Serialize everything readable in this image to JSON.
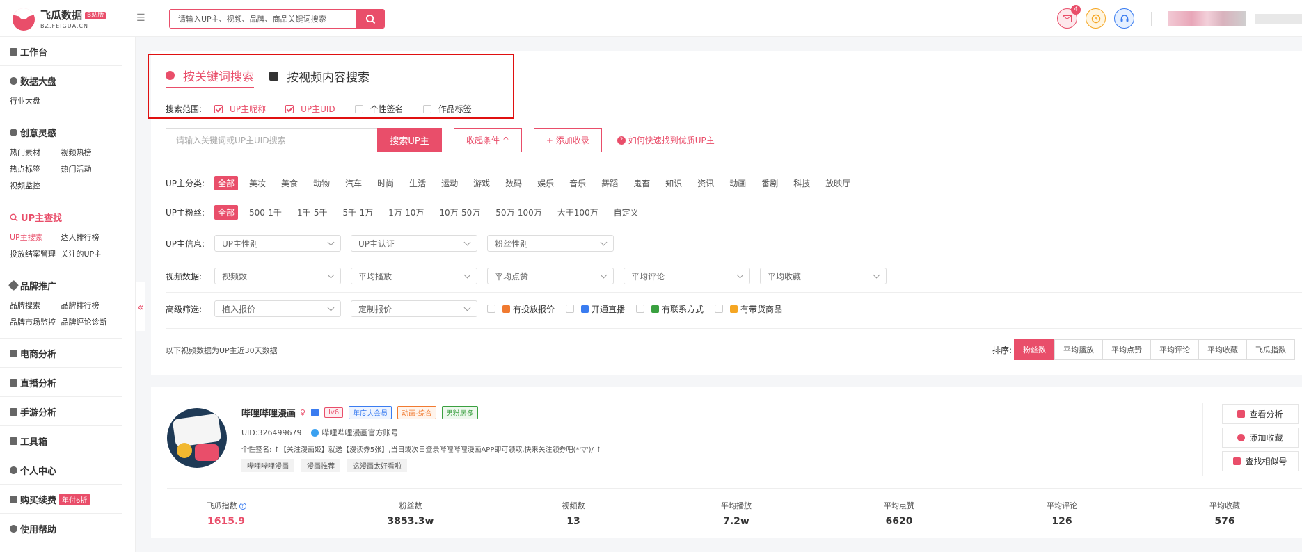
{
  "logo": {
    "name": "飞瓜数据",
    "badge": "B站版",
    "sub": "BZ.FEIGUA.CN"
  },
  "topbar": {
    "search_placeholder": "请输入UP主、视频、品牌、商品关键词搜索",
    "mail_count": "4"
  },
  "sidebar": {
    "groups": [
      {
        "title": "工作台",
        "items": []
      },
      {
        "title": "数据大盘",
        "items": [
          "行业大盘"
        ]
      },
      {
        "title": "创意灵感",
        "items": [
          "热门素材",
          "视频热榜",
          "热点标签",
          "热门活动",
          "视频监控"
        ]
      },
      {
        "title": "UP主查找",
        "items": [
          "UP主搜索",
          "达人排行榜",
          "投放结案管理",
          "关注的UP主"
        ]
      },
      {
        "title": "品牌推广",
        "items": [
          "品牌搜索",
          "品牌排行榜",
          "品牌市场监控",
          "品牌评论诊断"
        ]
      },
      {
        "title": "电商分析"
      },
      {
        "title": "直播分析"
      },
      {
        "title": "手游分析"
      },
      {
        "title": "工具箱"
      },
      {
        "title": "个人中心"
      },
      {
        "title": "购买续费",
        "badge": "年付6折"
      },
      {
        "title": "使用帮助"
      }
    ],
    "collapse": "«"
  },
  "tabs": [
    {
      "label": "按关键词搜索"
    },
    {
      "label": "按视频内容搜索"
    }
  ],
  "scope": {
    "label": "搜索范围:",
    "options": [
      "UP主昵称",
      "UP主UID",
      "个性签名",
      "作品标签"
    ]
  },
  "search": {
    "placeholder": "请输入关键词或UP主UID搜索",
    "button": "搜索UP主",
    "collapse": "收起条件 ^",
    "add": "+ 添加收录",
    "help": "如何快速找到优质UP主"
  },
  "filters": {
    "category": {
      "label": "UP主分类:",
      "options": [
        "全部",
        "美妆",
        "美食",
        "动物",
        "汽车",
        "时尚",
        "生活",
        "运动",
        "游戏",
        "数码",
        "娱乐",
        "音乐",
        "舞蹈",
        "鬼畜",
        "知识",
        "资讯",
        "动画",
        "番剧",
        "科技",
        "放映厅"
      ]
    },
    "fans": {
      "label": "UP主粉丝:",
      "options": [
        "全部",
        "500-1千",
        "1千-5千",
        "5千-1万",
        "1万-10万",
        "10万-50万",
        "50万-100万",
        "大于100万",
        "自定义"
      ]
    },
    "info": {
      "label": "UP主信息:",
      "selects": [
        "UP主性别",
        "UP主认证",
        "粉丝性别"
      ]
    },
    "video": {
      "label": "视频数据:",
      "selects": [
        "视频数",
        "平均播放",
        "平均点赞",
        "平均评论",
        "平均收藏"
      ]
    },
    "advanced": {
      "label": "高级筛选:",
      "selects": [
        "植入报价",
        "定制报价"
      ],
      "checks": [
        "有投放报价",
        "开通直播",
        "有联系方式",
        "有带货商品"
      ]
    }
  },
  "note": "以下视频数据为UP主近30天数据",
  "sort": {
    "label": "排序:",
    "options": [
      "粉丝数",
      "平均播放",
      "平均点赞",
      "平均评论",
      "平均收藏",
      "飞瓜指数"
    ]
  },
  "card": {
    "name": "哔哩哔哩漫画",
    "gender": "♀",
    "tags": [
      "lv6",
      "年度大会员",
      "动画-综合",
      "男粉居多"
    ],
    "uid": "UID:326499679",
    "verified": "哔哩哔哩漫画官方账号",
    "signature": "个性签名: ↑【关注漫画姬】就送【漫读券5张】,当日或次日登录哔哩哔哩漫画APP即可领取,快来关注领券吧(*'▽')/ ↑",
    "keywords": [
      "哔哩哔哩漫画",
      "漫画推荐",
      "这漫画太好看啦"
    ],
    "actions": [
      "查看分析",
      "添加收藏",
      "查找相似号"
    ],
    "stats": [
      {
        "label": "飞瓜指数",
        "value": "1615.9"
      },
      {
        "label": "粉丝数",
        "value": "3853.3w"
      },
      {
        "label": "视频数",
        "value": "13"
      },
      {
        "label": "平均播放",
        "value": "7.2w"
      },
      {
        "label": "平均点赞",
        "value": "6620"
      },
      {
        "label": "平均评论",
        "value": "126"
      },
      {
        "label": "平均收藏",
        "value": "576"
      }
    ]
  }
}
